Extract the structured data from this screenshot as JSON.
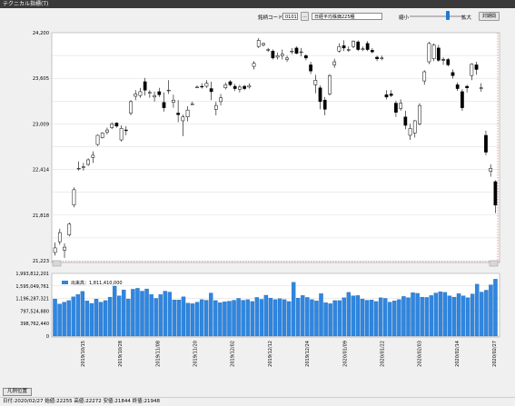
{
  "window": {
    "title": "テクニカル指標(T)"
  },
  "toolbar": {
    "code_label": "銘柄コード:",
    "code_value": "0101",
    "dots_label": "...",
    "name_value": "日経平均株価225種",
    "shrink_label": "縮小",
    "zoom_label": "拡大",
    "zoom_level": 0.67,
    "period_button": "対期間"
  },
  "price_axis_labels": [
    "24,200",
    "23,605",
    "23,009",
    "22,414",
    "21,818",
    "21,223"
  ],
  "volume_axis_labels": [
    "1,993,812,201",
    "1,595,049,761",
    "1,196,287,321",
    "797,524,880",
    "398,762,440",
    "0"
  ],
  "volume_legend": "出来高：1,811,410,000",
  "date_labels": [
    "2019/10/15",
    "2019/10/28",
    "2019/11/08",
    "2019/11/20",
    "2019/12/02",
    "2019/12/12",
    "2019/12/24",
    "2020/01/09",
    "2020/01/22",
    "2020/02/03",
    "2020/02/14",
    "2020/02/27"
  ],
  "bottom_button": "凡例位置",
  "status_text": "日付:2020/02/27 始値:22255 高値:22272 安値:21844 終値:21948",
  "colors": {
    "up_body": "#ffffff",
    "down_body": "#000000",
    "volume_bar": "#2f86e0",
    "grid": "#d0d0d0",
    "boundary": "#e05050"
  },
  "chart_data": {
    "type": "candlestick+bar",
    "price": {
      "ylim": [
        21223,
        24200
      ],
      "ohlc": [
        [
          21330,
          21460,
          21290,
          21390
        ],
        [
          21470,
          21640,
          21430,
          21590
        ],
        [
          21360,
          21450,
          21260,
          21400
        ],
        [
          21560,
          21720,
          21540,
          21700
        ],
        [
          21950,
          22180,
          21920,
          22150
        ],
        [
          22430,
          22520,
          22400,
          22430
        ],
        [
          22440,
          22500,
          22400,
          22450
        ],
        [
          22480,
          22560,
          22460,
          22540
        ],
        [
          22570,
          22650,
          22500,
          22600
        ],
        [
          22740,
          22870,
          22720,
          22860
        ],
        [
          22830,
          22900,
          22820,
          22890
        ],
        [
          22900,
          22960,
          22870,
          22930
        ],
        [
          22960,
          23030,
          22940,
          23010
        ],
        [
          23020,
          23030,
          22960,
          22980
        ],
        [
          22800,
          22990,
          22780,
          22950
        ],
        [
          22930,
          22980,
          22860,
          22920
        ],
        [
          23150,
          23320,
          23120,
          23300
        ],
        [
          23370,
          23450,
          23320,
          23400
        ],
        [
          23380,
          23480,
          23350,
          23430
        ],
        [
          23560,
          23610,
          23380,
          23450
        ],
        [
          23410,
          23450,
          23350,
          23420
        ],
        [
          23360,
          23430,
          23300,
          23380
        ],
        [
          23430,
          23480,
          23360,
          23390
        ],
        [
          23290,
          23420,
          23170,
          23220
        ],
        [
          23450,
          23580,
          23400,
          23450
        ],
        [
          23290,
          23390,
          23220,
          23320
        ],
        [
          23150,
          23320,
          23030,
          23130
        ],
        [
          23050,
          23130,
          22850,
          23100
        ],
        [
          23100,
          23240,
          23040,
          23190
        ],
        [
          23270,
          23300,
          23260,
          23270
        ],
        [
          23490,
          23510,
          23480,
          23490
        ],
        [
          23500,
          23540,
          23470,
          23490
        ],
        [
          23500,
          23580,
          23480,
          23540
        ],
        [
          23470,
          23560,
          23320,
          23430
        ],
        [
          23200,
          23300,
          23120,
          23250
        ],
        [
          23300,
          23400,
          23250,
          23350
        ],
        [
          23480,
          23550,
          23460,
          23520
        ],
        [
          23560,
          23580,
          23500,
          23520
        ],
        [
          23500,
          23530,
          23440,
          23470
        ],
        [
          23460,
          23520,
          23420,
          23490
        ],
        [
          23500,
          23520,
          23450,
          23470
        ],
        [
          23490,
          23540,
          23470,
          23510
        ],
        [
          23760,
          23830,
          23720,
          23800
        ],
        [
          24020,
          24130,
          24000,
          24100
        ],
        [
          24040,
          24070,
          24020,
          24060
        ],
        [
          23970,
          24000,
          23950,
          23980
        ],
        [
          23960,
          23980,
          23850,
          23870
        ],
        [
          23880,
          23940,
          23850,
          23900
        ],
        [
          23900,
          23980,
          23850,
          23920
        ],
        [
          23850,
          23900,
          23820,
          23870
        ],
        [
          23950,
          24000,
          23920,
          23960
        ],
        [
          24000,
          24020,
          23920,
          23930
        ],
        [
          23940,
          24000,
          23890,
          23950
        ],
        [
          23900,
          23920,
          23840,
          23870
        ],
        [
          23780,
          23820,
          23660,
          23700
        ],
        [
          23520,
          23650,
          23410,
          23580
        ],
        [
          23480,
          23510,
          23200,
          23300
        ],
        [
          23320,
          23360,
          23120,
          23200
        ],
        [
          23400,
          23660,
          23380,
          23640
        ],
        [
          23780,
          23860,
          23740,
          23820
        ],
        [
          23960,
          24060,
          23940,
          24020
        ],
        [
          24030,
          24100,
          23960,
          24000
        ],
        [
          23970,
          24020,
          23950,
          23980
        ],
        [
          24020,
          24100,
          24000,
          24090
        ],
        [
          24080,
          24100,
          23960,
          23980
        ],
        [
          23980,
          24020,
          23960,
          23990
        ],
        [
          24060,
          24090,
          23960,
          23980
        ],
        [
          23970,
          24000,
          23930,
          23950
        ],
        [
          23880,
          23900,
          23830,
          23860
        ],
        [
          23860,
          23900,
          23840,
          23870
        ],
        [
          23390,
          23450,
          23330,
          23360
        ],
        [
          23400,
          23450,
          23360,
          23380
        ],
        [
          23280,
          23310,
          23100,
          23160
        ],
        [
          23210,
          23330,
          23180,
          23280
        ],
        [
          23100,
          23180,
          22940,
          22990
        ],
        [
          22860,
          23010,
          22800,
          22950
        ],
        [
          22890,
          23060,
          22830,
          23050
        ],
        [
          23010,
          23280,
          22990,
          23250
        ],
        [
          23570,
          23710,
          23520,
          23690
        ],
        [
          23820,
          24080,
          23790,
          24060
        ],
        [
          23860,
          24060,
          23830,
          24040
        ],
        [
          24000,
          24040,
          23820,
          23840
        ],
        [
          23850,
          23880,
          23780,
          23840
        ],
        [
          23850,
          23870,
          23760,
          23780
        ],
        [
          23680,
          23720,
          23600,
          23640
        ],
        [
          23520,
          23550,
          23440,
          23470
        ],
        [
          23430,
          23460,
          23180,
          23220
        ],
        [
          23500,
          23520,
          23420,
          23480
        ],
        [
          23640,
          23800,
          23580,
          23790
        ],
        [
          23780,
          23820,
          23650,
          23720
        ],
        [
          23480,
          23540,
          23430,
          23480
        ],
        [
          22860,
          22920,
          22600,
          22640
        ],
        [
          22390,
          22480,
          22320,
          22430
        ],
        [
          22255,
          22272,
          21844,
          21948
        ]
      ]
    },
    "volume": {
      "ylim": [
        0,
        1993812201
      ],
      "values": [
        1180,
        1020,
        1080,
        1130,
        1250,
        1320,
        1420,
        1120,
        1040,
        1180,
        1080,
        1130,
        1240,
        1590,
        1280,
        1470,
        1180,
        1490,
        1520,
        1430,
        1500,
        1320,
        1200,
        1320,
        1430,
        1400,
        1150,
        1150,
        1250,
        1050,
        1030,
        1080,
        1160,
        1140,
        1370,
        1130,
        1060,
        1090,
        1110,
        1140,
        1200,
        1140,
        1160,
        1100,
        1230,
        1170,
        1300,
        1210,
        1160,
        1190,
        1160,
        1100,
        1710,
        1210,
        1290,
        1230,
        1160,
        1120,
        1350,
        1060,
        1030,
        1130,
        1130,
        1220,
        1390,
        1280,
        1290,
        1180,
        1140,
        1150,
        1100,
        1220,
        1200,
        1080,
        1120,
        1160,
        1260,
        1220,
        1380,
        1360,
        1240,
        1230,
        1290,
        1370,
        1410,
        1390,
        1280,
        1240,
        1350,
        1280,
        1220,
        1340,
        1650,
        1400,
        1460,
        1630,
        1810
      ]
    }
  }
}
